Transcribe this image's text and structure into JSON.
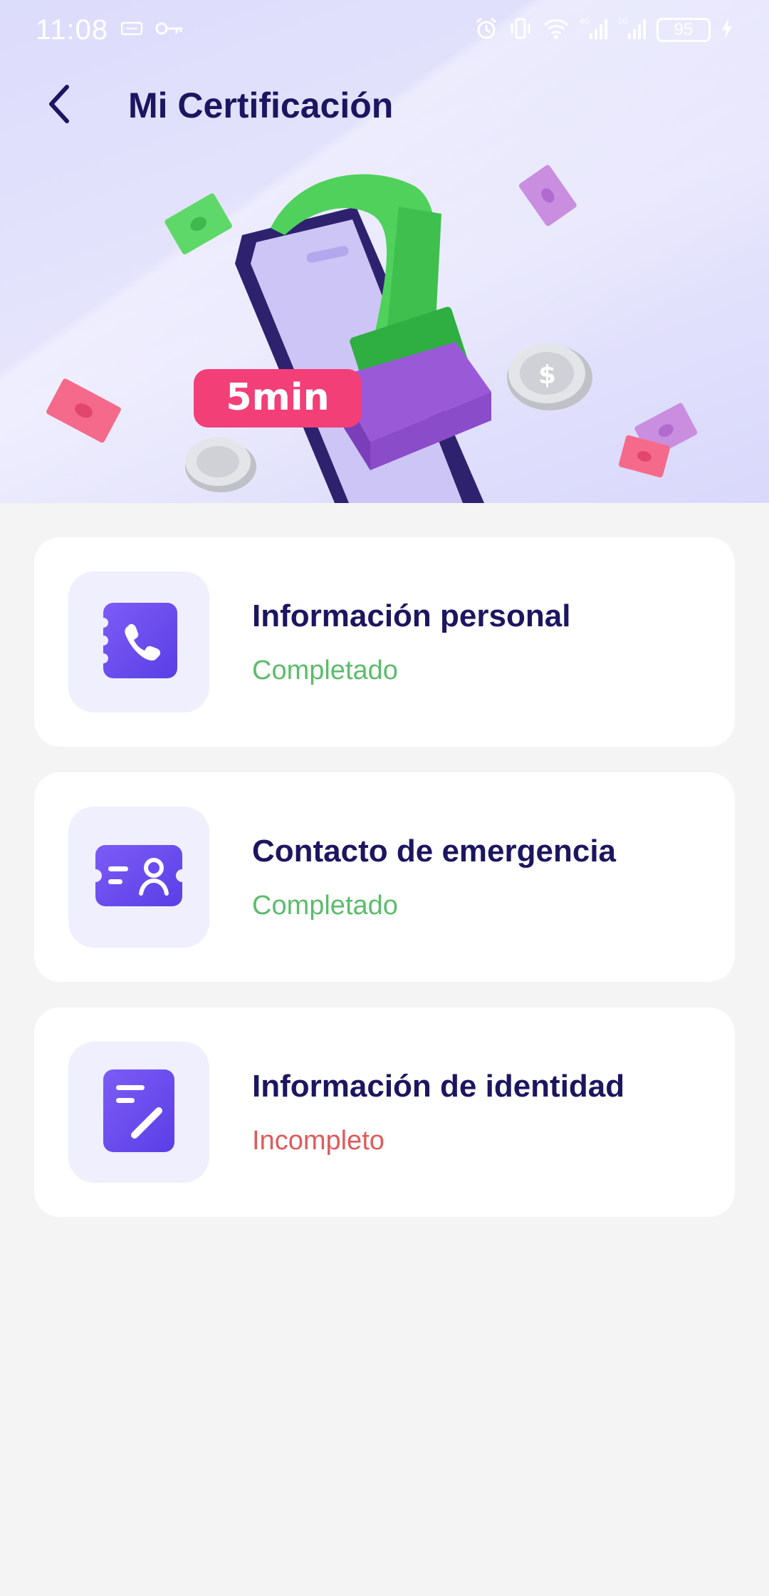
{
  "status_bar": {
    "time": "11:08",
    "battery": "95",
    "network_1": "4G",
    "network_2": "2G"
  },
  "header": {
    "title": "Mi Certificación",
    "back_icon": "chevron-left-icon"
  },
  "banner": {
    "badge_text": "5min"
  },
  "colors": {
    "title": "#1c1660",
    "completed": "#5cbc6b",
    "incomplete": "#e05a5a",
    "icon_accent": "#6a4ef0"
  },
  "cards": [
    {
      "title": "Información personal",
      "status": "Completado",
      "icon": "phone-book-icon"
    },
    {
      "title": "Contacto de emergencia",
      "status": "Completado",
      "icon": "id-card-icon"
    },
    {
      "title": "Información de identidad",
      "status": "Incompleto",
      "icon": "edit-document-icon"
    }
  ]
}
